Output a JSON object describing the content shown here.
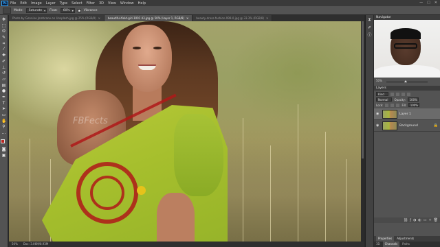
{
  "menubar": {
    "logo": "Ps",
    "items": [
      "File",
      "Edit",
      "Image",
      "Layer",
      "Type",
      "Select",
      "Filter",
      "3D",
      "View",
      "Window",
      "Help"
    ],
    "window_controls": [
      "—",
      "□",
      "✕"
    ]
  },
  "options": {
    "mode_label": "Mode:",
    "mode_value": "Saturate",
    "flow_label": "Flow:",
    "flow_value": "60%",
    "vibrance_label": "Vibrance"
  },
  "tabs": [
    {
      "label": "Photo by Gennine Jembrane on Unsplash.jpg @ 25% (RGB/8)",
      "active": false
    },
    {
      "label": "beautiful-field-girl-1001 43.jpg @ 50% (Layer 1, RGB/8)",
      "active": true
    },
    {
      "label": "beauty-dress-fashion-999-0.jpg @ 33.3% (RGB/8)",
      "active": false
    }
  ],
  "canvas": {
    "watermark": "FBFects"
  },
  "statusbar": {
    "zoom": "50%",
    "doc_info": "Doc: 3.06M/8.93M"
  },
  "panels": {
    "navigator_label": "Navigator",
    "nav_zoom": "50%",
    "layers_tab": "Layers",
    "kind_label": "Kind",
    "blend_mode": "Normal",
    "opacity_label": "Opacity:",
    "opacity_value": "100%",
    "lock_label": "Lock:",
    "fill_label": "Fill:",
    "fill_value": "100%",
    "layers": [
      {
        "name": "Layer 1",
        "selected": true
      },
      {
        "name": "Background",
        "selected": false
      }
    ],
    "bottom_tabs": [
      "Properties",
      "Adjustments"
    ],
    "bottom_tabs2": [
      "3D",
      "Channels",
      "Paths"
    ]
  },
  "colors": {
    "foreground": "#b8261f",
    "background": "#ffffff"
  }
}
